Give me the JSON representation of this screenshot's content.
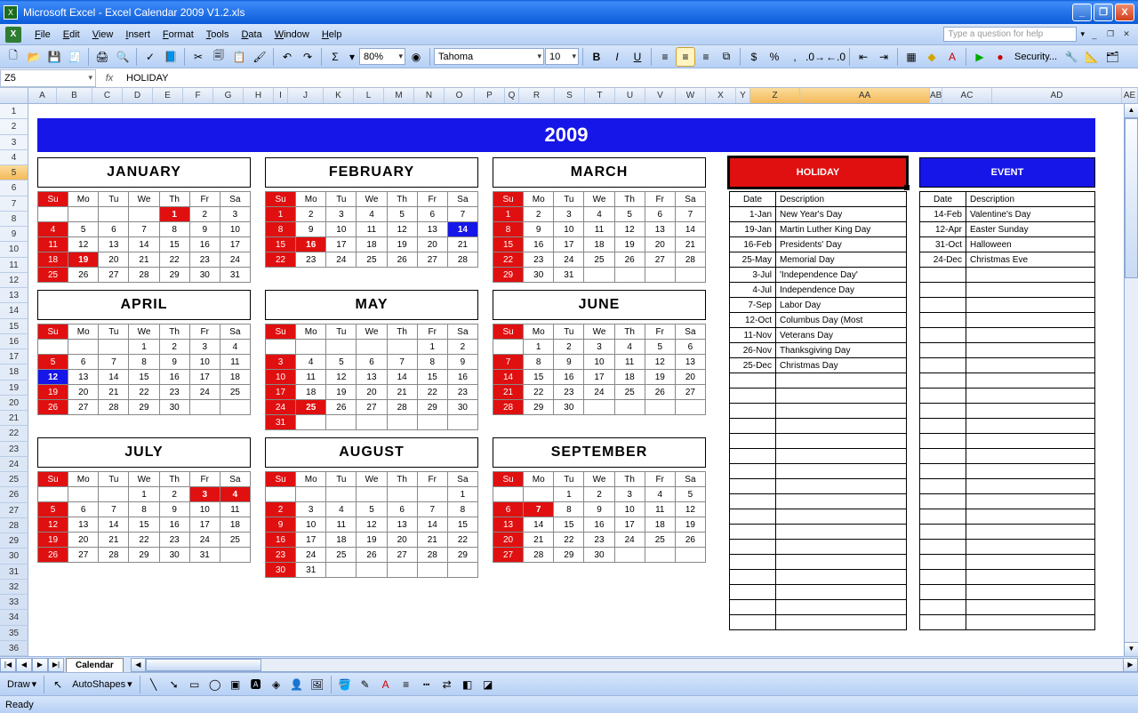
{
  "window": {
    "app": "Microsoft Excel",
    "doc": "Excel Calendar 2009 V1.2.xls"
  },
  "menus": [
    "File",
    "Edit",
    "View",
    "Insert",
    "Format",
    "Tools",
    "Data",
    "Window",
    "Help"
  ],
  "qhelp_placeholder": "Type a question for help",
  "toolbar1": {
    "zoom": "80%"
  },
  "toolbar2": {
    "font": "Tahoma",
    "size": "10",
    "security": "Security..."
  },
  "formula": {
    "cell": "Z5",
    "value": "HOLIDAY"
  },
  "colheaders": [
    "A",
    "B",
    "C",
    "D",
    "E",
    "F",
    "G",
    "H",
    "I",
    "J",
    "K",
    "L",
    "M",
    "N",
    "O",
    "P",
    "Q",
    "R",
    "S",
    "T",
    "U",
    "V",
    "W",
    "X",
    "Y",
    "Z",
    "AA",
    "AB",
    "AC",
    "AD",
    "AE"
  ],
  "selected_col_indices": [
    25,
    26
  ],
  "selected_row": 5,
  "year": "2009",
  "dow": [
    "Su",
    "Mo",
    "Tu",
    "We",
    "Th",
    "Fr",
    "Sa"
  ],
  "months": [
    {
      "name": "JANUARY",
      "start": 4,
      "days": 31,
      "hol": [
        1,
        19
      ],
      "evt": []
    },
    {
      "name": "FEBRUARY",
      "start": 0,
      "days": 28,
      "hol": [
        16
      ],
      "evt": [
        14
      ]
    },
    {
      "name": "MARCH",
      "start": 0,
      "days": 31,
      "hol": [],
      "evt": []
    },
    {
      "name": "APRIL",
      "start": 3,
      "days": 30,
      "hol": [],
      "evt": [
        12
      ]
    },
    {
      "name": "MAY",
      "start": 5,
      "days": 31,
      "hol": [
        25
      ],
      "evt": []
    },
    {
      "name": "JUNE",
      "start": 1,
      "days": 30,
      "hol": [],
      "evt": []
    },
    {
      "name": "JULY",
      "start": 3,
      "days": 31,
      "hol": [
        3,
        4
      ],
      "evt": []
    },
    {
      "name": "AUGUST",
      "start": 6,
      "days": 31,
      "hol": [],
      "evt": []
    },
    {
      "name": "SEPTEMBER",
      "start": 2,
      "days": 30,
      "hol": [
        7
      ],
      "evt": []
    }
  ],
  "holiday_header": "HOLIDAY",
  "event_header": "EVENT",
  "table_headers": {
    "date": "Date",
    "desc": "Description"
  },
  "holidays": [
    {
      "d": "1-Jan",
      "t": "New Year's Day"
    },
    {
      "d": "19-Jan",
      "t": "Martin Luther King Day"
    },
    {
      "d": "16-Feb",
      "t": "Presidents' Day"
    },
    {
      "d": "25-May",
      "t": "Memorial Day"
    },
    {
      "d": "3-Jul",
      "t": "'Independence Day'"
    },
    {
      "d": "4-Jul",
      "t": "Independence Day"
    },
    {
      "d": "7-Sep",
      "t": "Labor Day"
    },
    {
      "d": "12-Oct",
      "t": "Columbus Day (Most"
    },
    {
      "d": "11-Nov",
      "t": "Veterans Day"
    },
    {
      "d": "26-Nov",
      "t": "Thanksgiving Day"
    },
    {
      "d": "25-Dec",
      "t": "Christmas Day"
    }
  ],
  "events": [
    {
      "d": "14-Feb",
      "t": "Valentine's Day"
    },
    {
      "d": "12-Apr",
      "t": "Easter Sunday"
    },
    {
      "d": "31-Oct",
      "t": "Halloween"
    },
    {
      "d": "24-Dec",
      "t": "Christmas Eve"
    }
  ],
  "side_rows": 28,
  "tab": "Calendar",
  "draw": "Draw",
  "autoshapes": "AutoShapes",
  "status": "Ready"
}
